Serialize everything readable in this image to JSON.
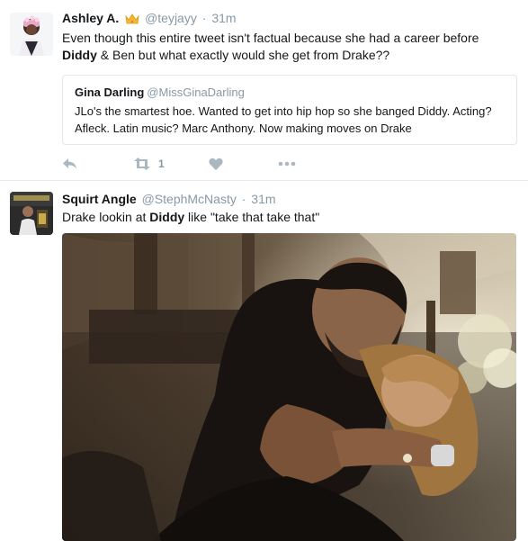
{
  "tweets": [
    {
      "name": "Ashley A.",
      "emoji_icon": "crown-icon",
      "handle": "@teyjayy",
      "separator": "·",
      "time": "31m",
      "text_before": "Even though this entire tweet isn't factual because she had a career before ",
      "text_bold": "Diddy",
      "text_after": " & Ben but what exactly would she get from Drake??",
      "quote": {
        "name": "Gina Darling",
        "handle": "@MissGinaDarling",
        "text": "JLo's the smartest hoe. Wanted to get into hip hop so she banged Diddy. Acting? Afleck. Latin music? Marc Anthony. Now making moves on Drake"
      },
      "actions": {
        "reply_icon": "reply-icon",
        "retweet_icon": "retweet-icon",
        "retweet_count": "1",
        "like_icon": "heart-icon",
        "more_icon": "more-dots-icon"
      }
    },
    {
      "name": "Squirt Angle",
      "handle": "@StephMcNasty",
      "separator": "·",
      "time": "31m",
      "text_before": "Drake lookin at ",
      "text_bold": "Diddy",
      "text_after": " like \"take that take that\""
    }
  ],
  "colors": {
    "text": "#14171a",
    "secondary": "#8899a6",
    "action_icons": "#aab8c2",
    "border": "#e1e8ed"
  }
}
